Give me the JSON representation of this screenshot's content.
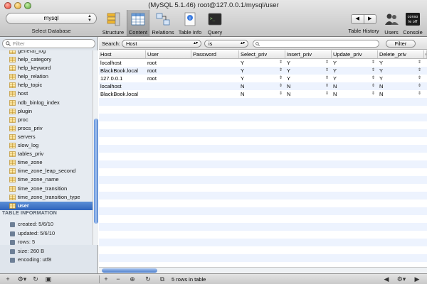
{
  "window": {
    "title": "(MySQL 5.1.46) root@127.0.0.1/mysql/user"
  },
  "toolbar": {
    "database": "mysql",
    "database_caption": "Select Database",
    "buttons": {
      "structure": "Structure",
      "content": "Content",
      "relations": "Relations",
      "table_info": "Table Info",
      "query": "Query",
      "table_history": "Table History",
      "users": "Users",
      "console": "Console"
    },
    "console_icon_text": "conso le off"
  },
  "sidebar": {
    "filter_placeholder": "Filter",
    "tables": [
      "general_log",
      "help_category",
      "help_keyword",
      "help_relation",
      "help_topic",
      "host",
      "ndb_binlog_index",
      "plugin",
      "proc",
      "procs_priv",
      "servers",
      "slow_log",
      "tables_priv",
      "time_zone",
      "time_zone_leap_second",
      "time_zone_name",
      "time_zone_transition",
      "time_zone_transition_type",
      "user"
    ],
    "selected_table": "user",
    "info_title": "TABLE INFORMATION",
    "info": [
      "created: 5/6/10",
      "updated: 5/6/10",
      "rows: 5",
      "size: 260 B",
      "encoding: utf8"
    ]
  },
  "filter_bar": {
    "search_label": "Search:",
    "field": "Host",
    "operator": "is",
    "value": "",
    "button": "Filter"
  },
  "grid": {
    "columns": [
      "Host",
      "User",
      "Password",
      "Select_priv",
      "Insert_priv",
      "Update_priv",
      "Delete_priv",
      "C"
    ],
    "rows": [
      [
        "localhost",
        "root",
        "",
        "Y",
        "Y",
        "Y",
        "Y"
      ],
      [
        "BlackBook.local",
        "root",
        "",
        "Y",
        "Y",
        "Y",
        "Y"
      ],
      [
        "127.0.0.1",
        "root",
        "",
        "Y",
        "Y",
        "Y",
        "Y"
      ],
      [
        "localhost",
        "",
        "",
        "N",
        "N",
        "N",
        "N"
      ],
      [
        "BlackBook.local",
        "",
        "",
        "N",
        "N",
        "N",
        "N"
      ]
    ]
  },
  "status": {
    "rows_in_table": "5 rows in table"
  },
  "colors": {
    "selection": "#2f64bd",
    "stripe": "#edf3fe",
    "sidebar_bg": "#dfe5ec"
  }
}
